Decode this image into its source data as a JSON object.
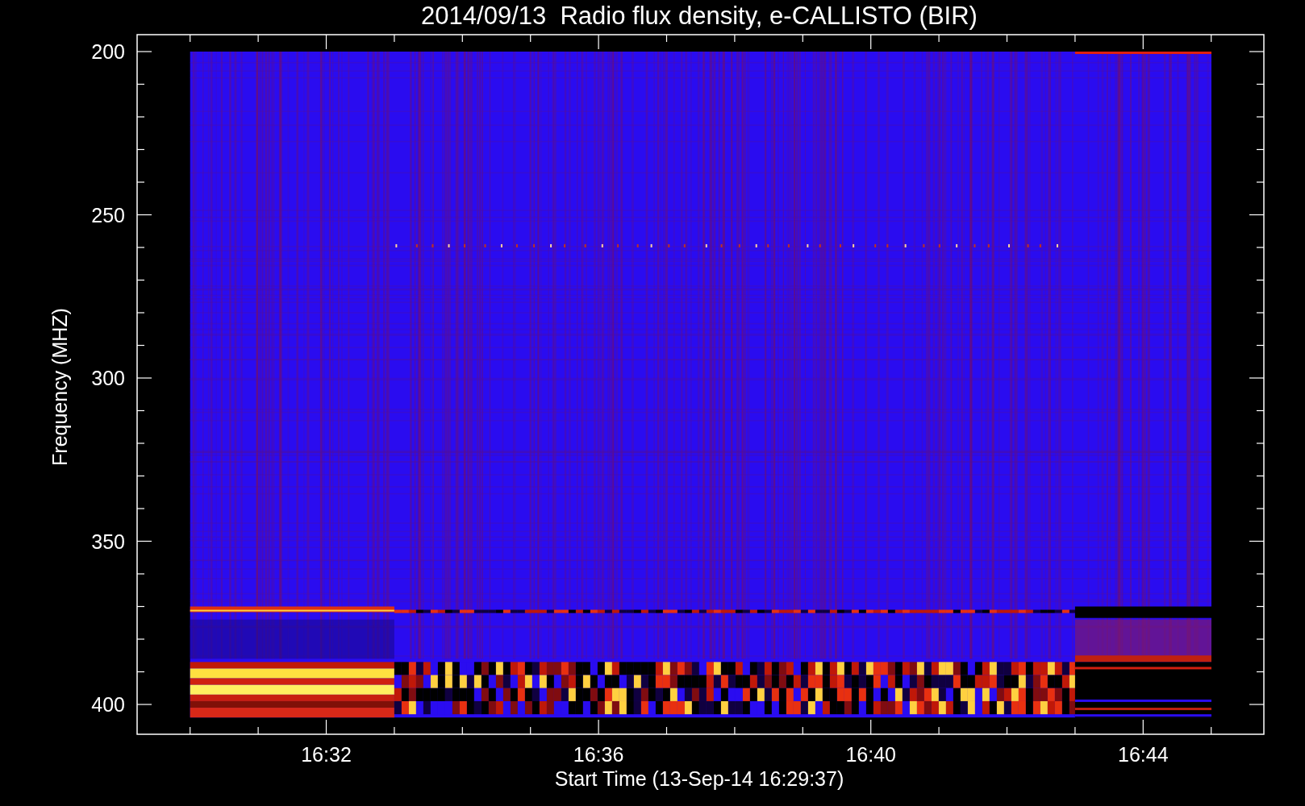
{
  "title": "2014/09/13  Radio flux density, e-CALLISTO (BIR)",
  "y_axis": {
    "label": "Frequency (MHZ)",
    "ticks": [
      "200",
      "250",
      "300",
      "350",
      "400"
    ]
  },
  "x_axis": {
    "label": "Start Time (13-Sep-14 16:29:37)",
    "ticks": [
      "16:32",
      "16:36",
      "16:40",
      "16:44"
    ]
  }
}
